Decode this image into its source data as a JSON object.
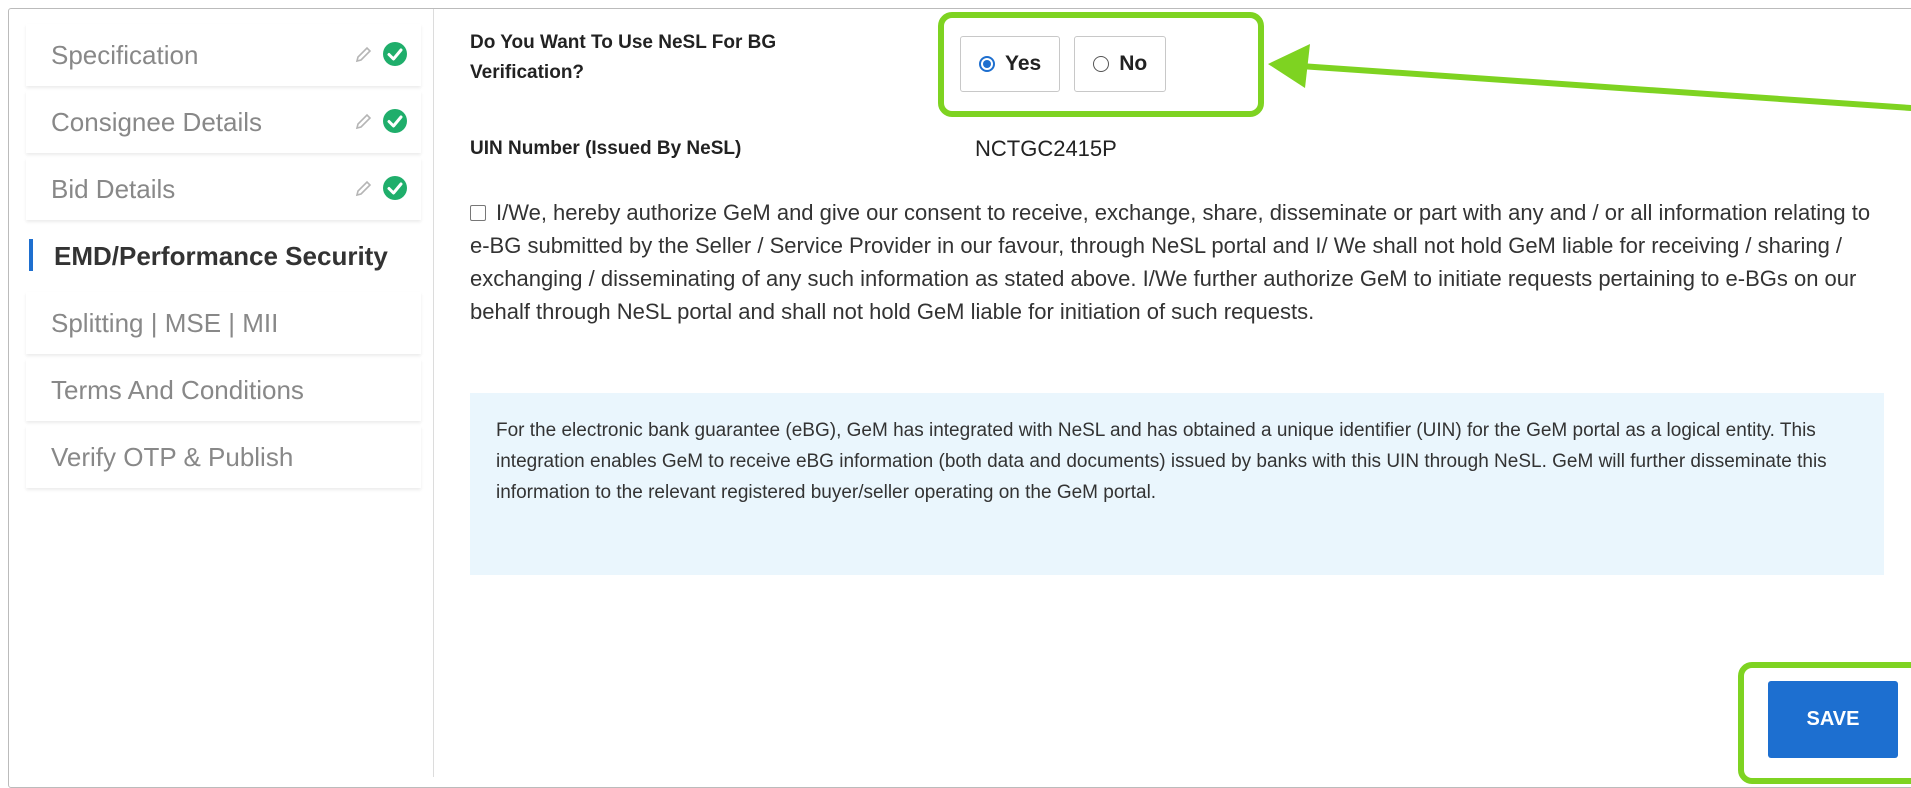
{
  "sidebar": {
    "items": [
      {
        "label": "Specification",
        "completed": true
      },
      {
        "label": "Consignee Details",
        "completed": true
      },
      {
        "label": "Bid Details",
        "completed": true
      },
      {
        "label": "EMD/Performance Security",
        "active": true
      },
      {
        "label": "Splitting | MSE | MII"
      },
      {
        "label": "Terms And Conditions"
      },
      {
        "label": "Verify OTP & Publish"
      }
    ]
  },
  "form": {
    "nesl_question": "Do You Want To Use NeSL For BG Verification?",
    "options": {
      "yes": "Yes",
      "no": "No",
      "selected": "Yes"
    },
    "uin_label": "UIN Number (Issued By NeSL)",
    "uin_value": "NCTGC2415P",
    "consent_text": "I/We, hereby authorize GeM and give our consent to receive, exchange, share, disseminate or part with any and / or all information relating to e-BG submitted by the Seller / Service Provider in our favour, through NeSL portal and I/ We shall not hold GeM liable for receiving / sharing / exchanging / disseminating of any such information as stated above. I/We further authorize GeM to initiate requests pertaining to e-BGs on our behalf through NeSL portal and shall not hold GeM liable for initiation of such requests.",
    "info_text": "For the electronic bank guarantee (eBG), GeM has integrated with NeSL and has obtained a unique identifier (UIN) for the GeM portal as a logical entity. This integration enables GeM to receive eBG information (both data and documents) issued by banks with this UIN through NeSL. GeM will further disseminate this information to the relevant registered buyer/seller operating on the GeM portal.",
    "save_label": "SAVE"
  },
  "colors": {
    "accent": "#1d6fd0",
    "highlight": "#7ed321",
    "info_bg": "#eaf6fd",
    "check": "#1fae6b"
  },
  "icons": {
    "edit": "pencil-icon",
    "done": "check-circle-icon"
  }
}
